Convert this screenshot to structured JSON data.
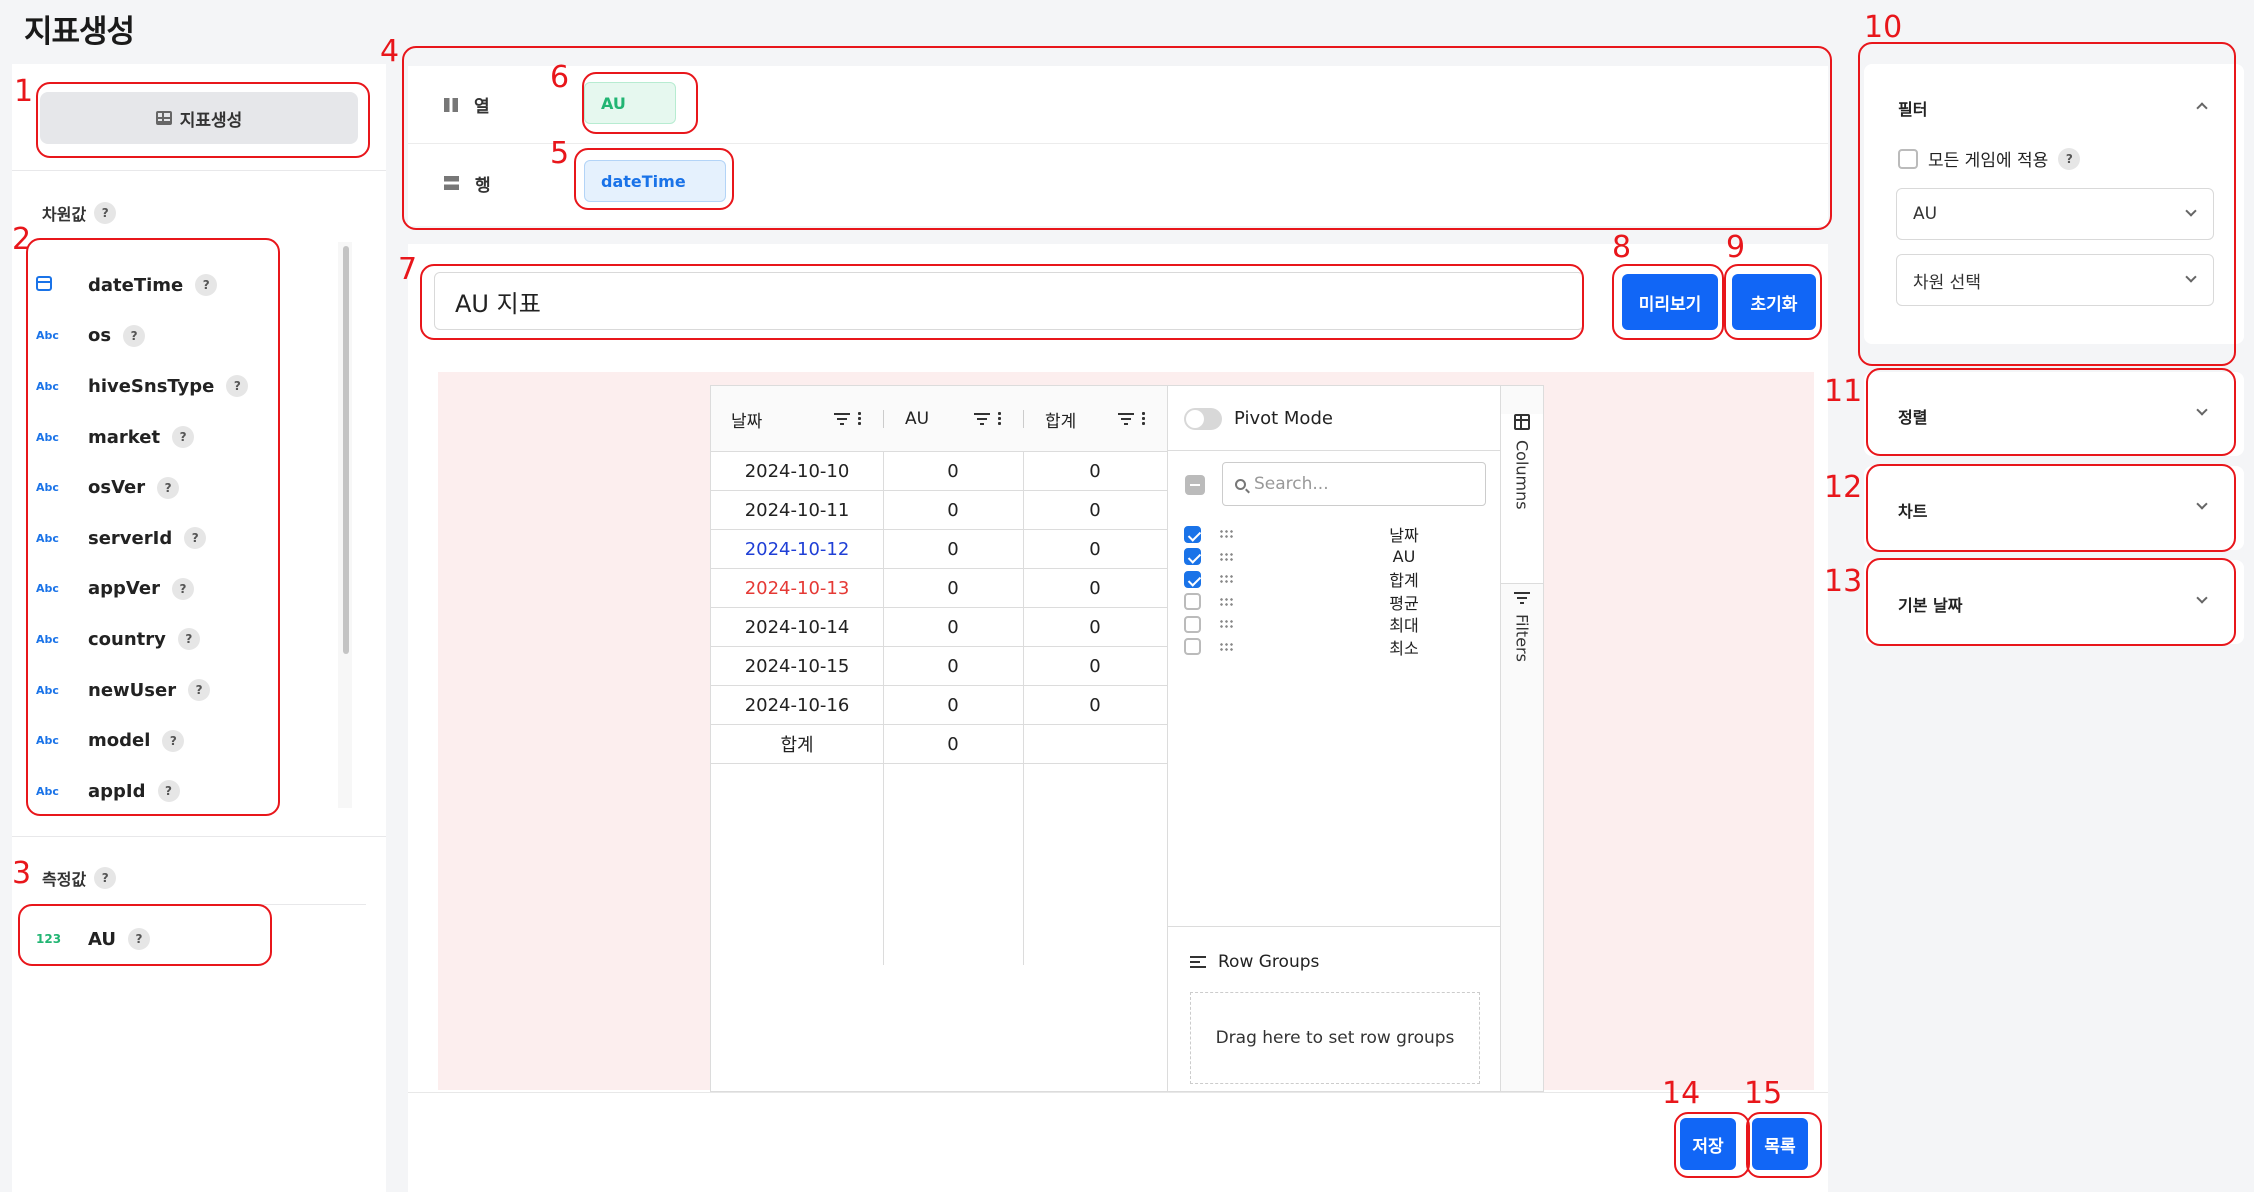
{
  "page": {
    "title": "지표생성"
  },
  "sidebar": {
    "create_button": "지표생성",
    "dimension_section": "차원값",
    "dimensions": [
      {
        "type": "calendar",
        "name": "dateTime"
      },
      {
        "type": "Abc",
        "name": "os"
      },
      {
        "type": "Abc",
        "name": "hiveSnsType"
      },
      {
        "type": "Abc",
        "name": "market"
      },
      {
        "type": "Abc",
        "name": "osVer"
      },
      {
        "type": "Abc",
        "name": "serverId"
      },
      {
        "type": "Abc",
        "name": "appVer"
      },
      {
        "type": "Abc",
        "name": "country"
      },
      {
        "type": "Abc",
        "name": "newUser"
      },
      {
        "type": "Abc",
        "name": "model"
      },
      {
        "type": "Abc",
        "name": "appId"
      }
    ],
    "measure_section": "측정값",
    "measures": [
      {
        "type": "123",
        "name": "AU"
      }
    ],
    "help": "?"
  },
  "config": {
    "column_label": "열",
    "column_chip": "AU",
    "row_label": "행",
    "row_chip": "dateTime"
  },
  "editor": {
    "title_value": "AU 지표",
    "preview_button": "미리보기",
    "reset_button": "초기화",
    "save_button": "저장",
    "list_button": "목록"
  },
  "grid": {
    "headers": [
      "날짜",
      "AU",
      "합계"
    ],
    "rows": [
      {
        "date": "2024-10-10",
        "au": "0",
        "total": "0",
        "color": "#222222"
      },
      {
        "date": "2024-10-11",
        "au": "0",
        "total": "0",
        "color": "#222222"
      },
      {
        "date": "2024-10-12",
        "au": "0",
        "total": "0",
        "color": "#1f3fd6"
      },
      {
        "date": "2024-10-13",
        "au": "0",
        "total": "0",
        "color": "#e53935"
      },
      {
        "date": "2024-10-14",
        "au": "0",
        "total": "0",
        "color": "#222222"
      },
      {
        "date": "2024-10-15",
        "au": "0",
        "total": "0",
        "color": "#222222"
      },
      {
        "date": "2024-10-16",
        "au": "0",
        "total": "0",
        "color": "#222222"
      }
    ],
    "footer": {
      "label": "합계",
      "au": "0",
      "total": ""
    },
    "tool_panel": {
      "pivot_mode": "Pivot Mode",
      "search_placeholder": "Search...",
      "columns": [
        {
          "name": "날짜",
          "checked": true
        },
        {
          "name": "AU",
          "checked": true
        },
        {
          "name": "합계",
          "checked": true
        },
        {
          "name": "평균",
          "checked": false
        },
        {
          "name": "최대",
          "checked": false
        },
        {
          "name": "최소",
          "checked": false
        }
      ],
      "row_groups_title": "Row Groups",
      "row_groups_hint": "Drag here to set row groups",
      "tab_columns": "Columns",
      "tab_filters": "Filters"
    }
  },
  "right_panel": {
    "filter_title": "필터",
    "apply_all_label": "모든 게임에 적용",
    "metric_select": "AU",
    "dimension_select": "차원 선택",
    "sort_title": "정렬",
    "chart_title": "차트",
    "default_date_title": "기본 날짜"
  },
  "annotations": [
    "1",
    "2",
    "3",
    "4",
    "5",
    "6",
    "7",
    "8",
    "9",
    "10",
    "11",
    "12",
    "13",
    "14",
    "15"
  ],
  "colors": {
    "accent": "#1166f6",
    "annotation": "#e8161b",
    "measure": "#22b573",
    "dimension": "#1a73e8"
  }
}
